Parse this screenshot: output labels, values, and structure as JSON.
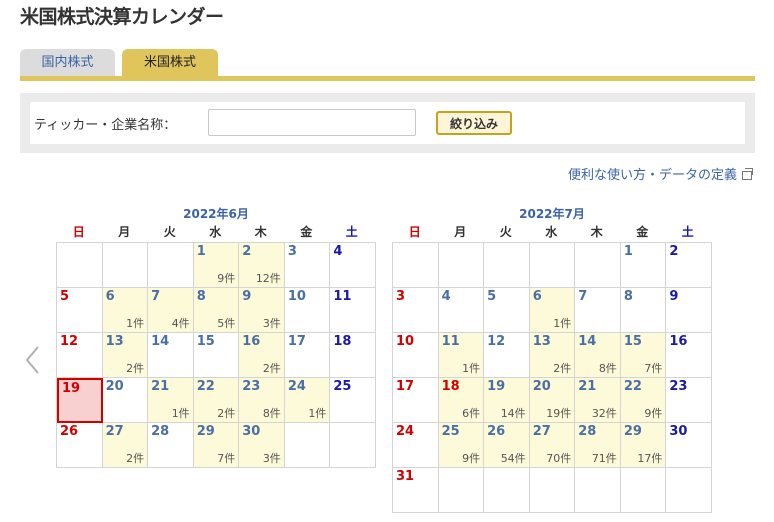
{
  "page": {
    "title": "米国株式決算カレンダー"
  },
  "tabs": [
    {
      "label": "国内株式",
      "active": false
    },
    {
      "label": "米国株式",
      "active": true
    }
  ],
  "search": {
    "label": "ティッカー・企業名称：",
    "value": "",
    "placeholder": "",
    "button_label": "絞り込み"
  },
  "help_link": {
    "label": "便利な使い方・データの定義",
    "icon": "external-link-icon"
  },
  "nav": {
    "prev_icon": "chevron-left-icon"
  },
  "colors": {
    "accent": "#e0c45c",
    "link": "#3a63a6",
    "sunday": "#d40000",
    "saturday": "#1a1aa8",
    "event_bg": "#fdfad9",
    "today_bg": "#f9d0d0"
  },
  "weekdays": [
    "日",
    "月",
    "火",
    "水",
    "木",
    "金",
    "土"
  ],
  "calendars": [
    {
      "title": "2022年6月",
      "weeks": [
        [
          null,
          null,
          null,
          {
            "d": "1",
            "c": "9件"
          },
          {
            "d": "2",
            "c": "12件"
          },
          {
            "d": "3"
          },
          {
            "d": "4"
          }
        ],
        [
          {
            "d": "5"
          },
          {
            "d": "6",
            "c": "1件"
          },
          {
            "d": "7",
            "c": "4件"
          },
          {
            "d": "8",
            "c": "5件"
          },
          {
            "d": "9",
            "c": "3件"
          },
          {
            "d": "10"
          },
          {
            "d": "11"
          }
        ],
        [
          {
            "d": "12"
          },
          {
            "d": "13",
            "c": "2件"
          },
          {
            "d": "14"
          },
          {
            "d": "15"
          },
          {
            "d": "16",
            "c": "2件"
          },
          {
            "d": "17"
          },
          {
            "d": "18"
          }
        ],
        [
          {
            "d": "19",
            "today": true
          },
          {
            "d": "20"
          },
          {
            "d": "21",
            "c": "1件"
          },
          {
            "d": "22",
            "c": "2件"
          },
          {
            "d": "23",
            "c": "8件"
          },
          {
            "d": "24",
            "c": "1件"
          },
          {
            "d": "25"
          }
        ],
        [
          {
            "d": "26"
          },
          {
            "d": "27",
            "c": "2件"
          },
          {
            "d": "28"
          },
          {
            "d": "29",
            "c": "7件"
          },
          {
            "d": "30",
            "c": "3件"
          },
          null,
          null
        ]
      ]
    },
    {
      "title": "2022年7月",
      "weeks": [
        [
          null,
          null,
          null,
          null,
          null,
          {
            "d": "1"
          },
          {
            "d": "2"
          }
        ],
        [
          {
            "d": "3"
          },
          {
            "d": "4"
          },
          {
            "d": "5"
          },
          {
            "d": "6",
            "c": "1件"
          },
          {
            "d": "7"
          },
          {
            "d": "8"
          },
          {
            "d": "9"
          }
        ],
        [
          {
            "d": "10"
          },
          {
            "d": "11",
            "c": "1件"
          },
          {
            "d": "12"
          },
          {
            "d": "13",
            "c": "2件"
          },
          {
            "d": "14",
            "c": "8件"
          },
          {
            "d": "15",
            "c": "7件"
          },
          {
            "d": "16"
          }
        ],
        [
          {
            "d": "17"
          },
          {
            "d": "18",
            "c": "6件",
            "hol": true
          },
          {
            "d": "19",
            "c": "14件"
          },
          {
            "d": "20",
            "c": "19件"
          },
          {
            "d": "21",
            "c": "32件"
          },
          {
            "d": "22",
            "c": "9件"
          },
          {
            "d": "23"
          }
        ],
        [
          {
            "d": "24"
          },
          {
            "d": "25",
            "c": "9件"
          },
          {
            "d": "26",
            "c": "54件"
          },
          {
            "d": "27",
            "c": "70件"
          },
          {
            "d": "28",
            "c": "71件"
          },
          {
            "d": "29",
            "c": "17件"
          },
          {
            "d": "30"
          }
        ],
        [
          {
            "d": "31"
          },
          null,
          null,
          null,
          null,
          null,
          null
        ]
      ]
    }
  ]
}
